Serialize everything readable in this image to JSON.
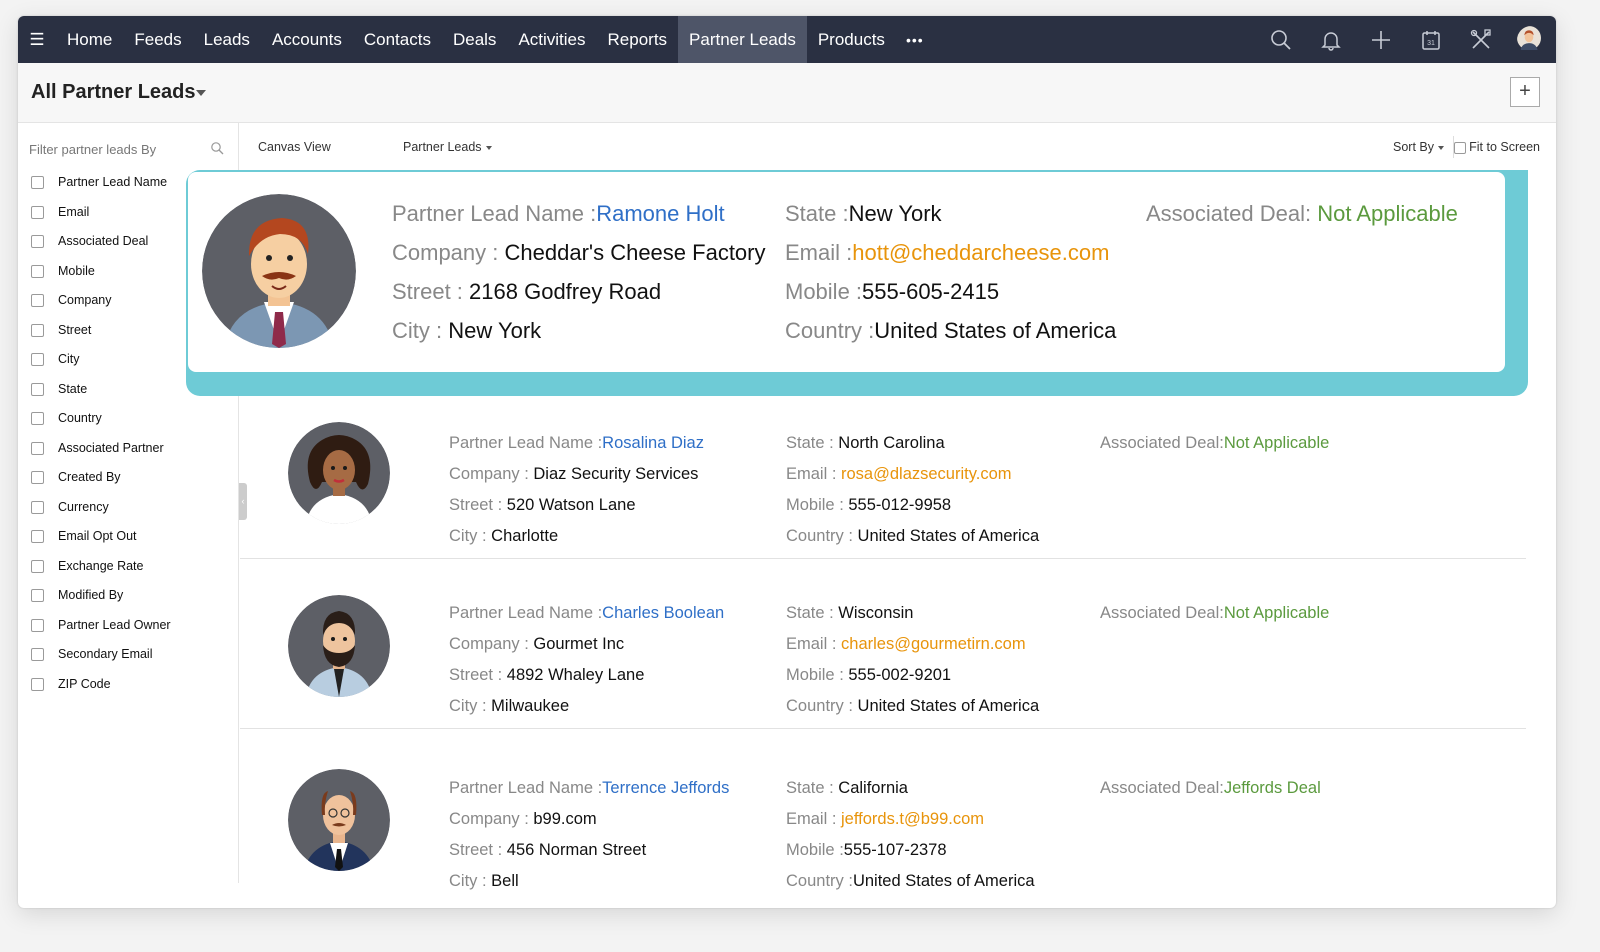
{
  "nav": {
    "items": [
      "Home",
      "Feeds",
      "Leads",
      "Accounts",
      "Contacts",
      "Deals",
      "Activities",
      "Reports",
      "Partner Leads",
      "Products"
    ],
    "active": "Partner Leads",
    "more": "•••",
    "icons": [
      "search-icon",
      "bell-icon",
      "plus-icon",
      "calendar-icon",
      "tools-icon",
      "user-avatar"
    ],
    "calendar_day": "31"
  },
  "header": {
    "title": "All Partner Leads",
    "add_label": "+"
  },
  "sidebar": {
    "filter_placeholder": "Filter partner leads By",
    "fields": [
      "Partner Lead Name",
      "Email",
      "Associated Deal",
      "Mobile",
      "Company",
      "Street",
      "City",
      "State",
      "Country",
      "Associated Partner",
      "Created By",
      "Currency",
      "Email Opt Out",
      "Exchange Rate",
      "Modified By",
      "Partner Lead Owner",
      "Secondary Email",
      "ZIP Code"
    ]
  },
  "toolbar": {
    "view": "Canvas View",
    "module": "Partner Leads",
    "sort": "Sort By",
    "fit": "Fit to Screen"
  },
  "labels": {
    "name_featured": "Partner Lead Name :",
    "company_featured": "Company : ",
    "street_featured": "Street : ",
    "city_featured": "City : ",
    "state_featured": "State :",
    "email_featured": "Email :",
    "mobile_featured": "Mobile :",
    "country_featured": "Country :",
    "deal_featured": "Associated Deal: ",
    "name": "Partner Lead Name :",
    "company": "Company : ",
    "street": "Street : ",
    "city": "City : ",
    "state": "State : ",
    "email": "Email : ",
    "mobile": "Mobile : ",
    "country": "Country : ",
    "deal": "Associated Deal:"
  },
  "records": [
    {
      "name": "Ramone Holt",
      "company": "Cheddar's Cheese Factory",
      "street": "2168 Godfrey Road",
      "city": "New York",
      "state": "New York",
      "email": "hott@cheddarcheese.com",
      "mobile": "555-605-2415",
      "country": "United States of America",
      "deal": "Not Applicable"
    },
    {
      "name": "Rosalina Diaz",
      "company": "Diaz Security Services",
      "street": "520 Watson Lane",
      "city": "Charlotte",
      "state": "North Carolina",
      "email": "rosa@dlazsecurity.com",
      "mobile": "555-012-9958",
      "country": "United States of America",
      "deal": "Not Applicable"
    },
    {
      "name": "Charles Boolean",
      "company": "Gourmet Inc",
      "street": "4892 Whaley Lane",
      "city": "Milwaukee",
      "state": "Wisconsin",
      "email": "charles@gourmetirn.com",
      "mobile": "555-002-9201",
      "country": "United States of America",
      "deal": "Not Applicable"
    },
    {
      "name": "Terrence Jeffords",
      "company": "b99.com",
      "street": "456 Norman Street",
      "city": "Bell",
      "state": "California",
      "email": "jeffords.t@b99.com",
      "mobile": "555-107-2378",
      "country": "United States of America",
      "deal": "Jeffords Deal"
    }
  ],
  "colors": {
    "nav_bg": "#2a3042",
    "nav_active": "#4e5568",
    "accent_teal": "#6ecbd6",
    "link_blue": "#2f6fc7",
    "email_orange": "#e8940b",
    "deal_green": "#5b9a3e"
  }
}
